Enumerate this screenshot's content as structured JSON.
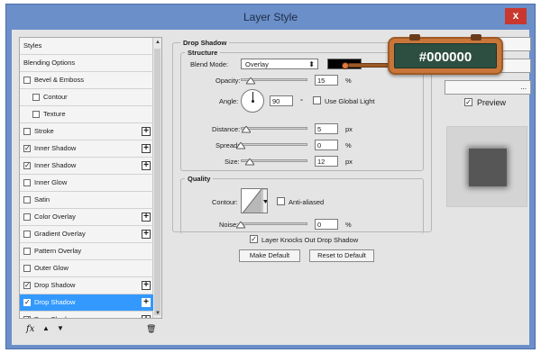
{
  "window": {
    "title": "Layer Style",
    "close_glyph": "x"
  },
  "style_list": {
    "items": [
      {
        "label": "Styles",
        "has_checkbox": false,
        "checked": false,
        "has_plus": false,
        "indent": false,
        "selected": false
      },
      {
        "label": "Blending Options",
        "has_checkbox": false,
        "checked": false,
        "has_plus": false,
        "indent": false,
        "selected": false
      },
      {
        "label": "Bevel & Emboss",
        "has_checkbox": true,
        "checked": false,
        "has_plus": false,
        "indent": false,
        "selected": false
      },
      {
        "label": "Contour",
        "has_checkbox": true,
        "checked": false,
        "has_plus": false,
        "indent": true,
        "selected": false
      },
      {
        "label": "Texture",
        "has_checkbox": true,
        "checked": false,
        "has_plus": false,
        "indent": true,
        "selected": false
      },
      {
        "label": "Stroke",
        "has_checkbox": true,
        "checked": false,
        "has_plus": true,
        "indent": false,
        "selected": false
      },
      {
        "label": "Inner Shadow",
        "has_checkbox": true,
        "checked": true,
        "has_plus": true,
        "indent": false,
        "selected": false
      },
      {
        "label": "Inner Shadow",
        "has_checkbox": true,
        "checked": true,
        "has_plus": true,
        "indent": false,
        "selected": false
      },
      {
        "label": "Inner Glow",
        "has_checkbox": true,
        "checked": false,
        "has_plus": false,
        "indent": false,
        "selected": false
      },
      {
        "label": "Satin",
        "has_checkbox": true,
        "checked": false,
        "has_plus": false,
        "indent": false,
        "selected": false
      },
      {
        "label": "Color Overlay",
        "has_checkbox": true,
        "checked": false,
        "has_plus": true,
        "indent": false,
        "selected": false
      },
      {
        "label": "Gradient Overlay",
        "has_checkbox": true,
        "checked": false,
        "has_plus": true,
        "indent": false,
        "selected": false
      },
      {
        "label": "Pattern Overlay",
        "has_checkbox": true,
        "checked": false,
        "has_plus": false,
        "indent": false,
        "selected": false
      },
      {
        "label": "Outer Glow",
        "has_checkbox": true,
        "checked": false,
        "has_plus": false,
        "indent": false,
        "selected": false
      },
      {
        "label": "Drop Shadow",
        "has_checkbox": true,
        "checked": true,
        "has_plus": true,
        "indent": false,
        "selected": false
      },
      {
        "label": "Drop Shadow",
        "has_checkbox": true,
        "checked": true,
        "has_plus": true,
        "indent": false,
        "selected": true
      },
      {
        "label": "Drop Shadow",
        "has_checkbox": true,
        "checked": true,
        "has_plus": true,
        "indent": false,
        "selected": false,
        "partial": true
      }
    ],
    "toolbar": {
      "fx_icon": "fx-icon",
      "up_icon": "arrow-up-icon",
      "down_icon": "arrow-down-icon",
      "trash_icon": "trash-icon"
    }
  },
  "drop_shadow": {
    "title": "Drop Shadow",
    "structure": {
      "title": "Structure",
      "blend_mode_label": "Blend Mode:",
      "blend_mode_value": "Overlay",
      "swatch_color": "#000000",
      "opacity_label": "Opacity:",
      "opacity_value": "15",
      "opacity_unit": "%",
      "opacity_level": 0.15,
      "angle_label": "Angle:",
      "angle_value": "90",
      "angle_unit": "°",
      "use_global_light_label": "Use Global Light",
      "use_global_light_checked": false,
      "distance_label": "Distance:",
      "distance_value": "5",
      "distance_unit": "px",
      "spread_label": "Spread:",
      "spread_value": "0",
      "spread_unit": "%",
      "size_label": "Size:",
      "size_value": "12",
      "size_unit": "px"
    },
    "quality": {
      "title": "Quality",
      "contour_label": "Contour:",
      "anti_aliased_label": "Anti-aliased",
      "anti_aliased_checked": false,
      "noise_label": "Noise:",
      "noise_value": "0",
      "noise_unit": "%"
    },
    "knockout_label": "Layer Knocks Out Drop Shadow",
    "knockout_checked": true,
    "make_default_label": "Make Default",
    "reset_default_label": "Reset to Default"
  },
  "right_panel": {
    "preview_label": "Preview",
    "preview_checked": true,
    "third_button_label": "..."
  },
  "badge": {
    "text": "#000000",
    "bg_color": "#2d4f41",
    "frame_color": "#c8763a"
  }
}
